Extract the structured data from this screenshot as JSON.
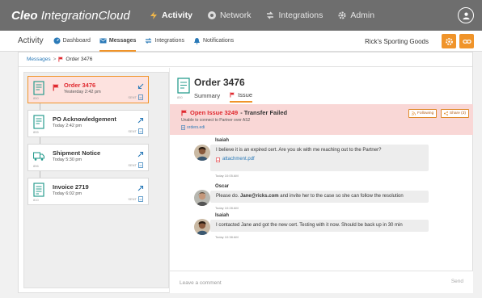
{
  "topbar": {
    "brand_bold": "Cleo",
    "brand_rest": "IntegrationCloud",
    "nav": [
      {
        "label": "Activity",
        "icon": "activity-icon",
        "active": true
      },
      {
        "label": "Network",
        "icon": "network-icon",
        "active": false
      },
      {
        "label": "Integrations",
        "icon": "integrations-icon",
        "active": false
      },
      {
        "label": "Admin",
        "icon": "gear-icon",
        "active": false
      }
    ]
  },
  "subnav": {
    "title": "Activity",
    "items": [
      {
        "label": "Dashboard",
        "icon": "dashboard-icon"
      },
      {
        "label": "Messages",
        "icon": "messages-icon"
      },
      {
        "label": "Integrations",
        "icon": "integrations-icon"
      },
      {
        "label": "Notifications",
        "icon": "bell-icon"
      }
    ],
    "account": "Rick's Sporting Goods"
  },
  "breadcrumb": {
    "parent": "Messages",
    "sep": ">",
    "current": "Order 3476"
  },
  "documents": [
    {
      "title": "Order 3476",
      "time": "Yesterday 2:42 pm",
      "tag": "850",
      "sent": "SENT",
      "selected": true
    },
    {
      "title": "PO Acknowledgement",
      "time": "Today 2:42 pm",
      "tag": "855",
      "sent": "SENT",
      "selected": false
    },
    {
      "title": "Shipment Notice",
      "time": "Today 5:30 pm",
      "tag": "856",
      "sent": "SENT",
      "selected": false
    },
    {
      "title": "Invoice 2719",
      "time": "Today 6:02 pm",
      "tag": "810",
      "sent": "SENT",
      "selected": false
    }
  ],
  "order": {
    "tag": "850",
    "title": "Order 3476",
    "tabs": [
      "Summary",
      "Issue"
    ]
  },
  "issue": {
    "id": "Open Issue 3249",
    "title": " - Transfer Failed",
    "subtitle": "Unable to connect to Partner over AS2",
    "file": "orders.edi",
    "following_label": "Following",
    "share_label": "Share (3)"
  },
  "messages": [
    {
      "name": "Isaiah",
      "text": "I believe it is an expired cert. Are you ok with me reaching out to the Partner?",
      "attachment": "attachment.pdf",
      "time": "Today  10:05 AM"
    },
    {
      "name": "Oscar",
      "text_pre": "Please do. ",
      "text_bold": "Jane@ricks.com",
      "text_post": " and invite her to the case so she can follow the resolution",
      "time": "Today  10:28 AM"
    },
    {
      "name": "Isaiah",
      "text": "I contacted Jane and got the new cert. Testing with it now. Should be back up in 30 min",
      "time": "Today  10:38 AM"
    }
  ],
  "comment": {
    "placeholder": "Leave a comment",
    "send_label": "Send"
  },
  "colors": {
    "accent": "#f0942a",
    "alert_red": "#e0282e",
    "link_blue": "#2a7ab8",
    "topbar": "#6e6e6e",
    "issue_bg": "#f9d7d6"
  }
}
